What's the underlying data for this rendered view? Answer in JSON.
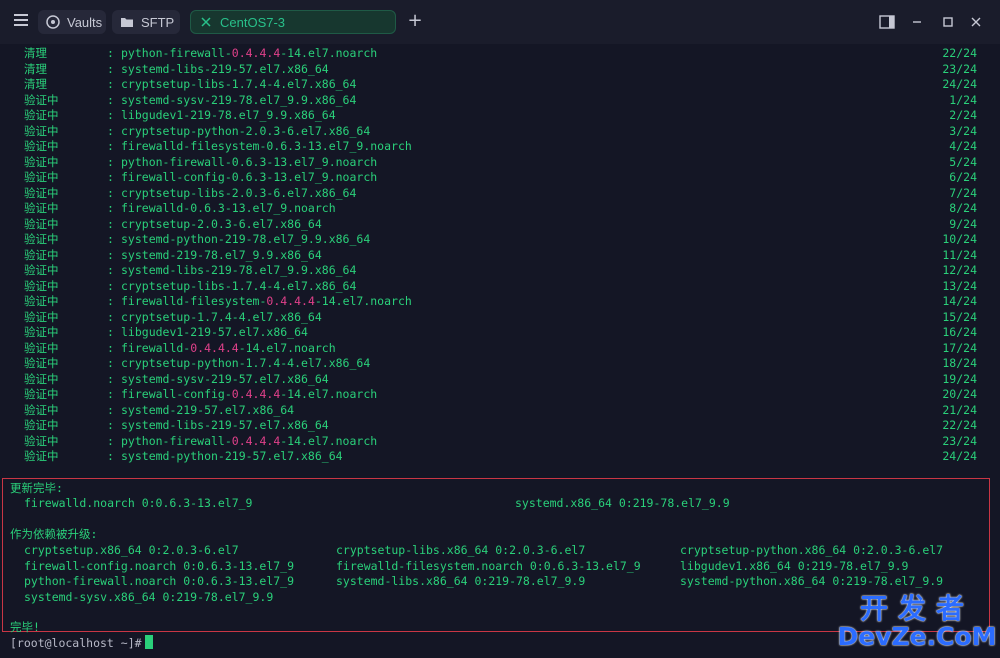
{
  "tabs": [
    {
      "label": "Vaults",
      "icon": "vault-icon"
    },
    {
      "label": "SFTP",
      "icon": "folder-icon"
    },
    {
      "label": "CentOS7-3",
      "icon": "close-icon"
    }
  ],
  "colors": {
    "accent": "#28c08a",
    "text": "#2ad07a",
    "highlight": "#e0408a",
    "frame": "#c93645",
    "background": "#141625"
  },
  "rows": [
    {
      "status": "清理",
      "pkg_pre": "python-firewall-",
      "pkg_ver": "0.4.4.4",
      "pkg_post": "-14.el7.noarch",
      "count": "22/24"
    },
    {
      "status": "清理",
      "pkg_pre": "systemd-libs-219-57.el7.x86_64",
      "pkg_ver": "",
      "pkg_post": "",
      "count": "23/24"
    },
    {
      "status": "清理",
      "pkg_pre": "cryptsetup-libs-1.7.4-4.el7.x86_64",
      "pkg_ver": "",
      "pkg_post": "",
      "count": "24/24"
    },
    {
      "status": "验证中",
      "pkg_pre": "systemd-sysv-219-78.el7_9.9.x86_64",
      "pkg_ver": "",
      "pkg_post": "",
      "count": "1/24"
    },
    {
      "status": "验证中",
      "pkg_pre": "libgudev1-219-78.el7_9.9.x86_64",
      "pkg_ver": "",
      "pkg_post": "",
      "count": "2/24"
    },
    {
      "status": "验证中",
      "pkg_pre": "cryptsetup-python-2.0.3-6.el7.x86_64",
      "pkg_ver": "",
      "pkg_post": "",
      "count": "3/24"
    },
    {
      "status": "验证中",
      "pkg_pre": "firewalld-filesystem-0.6.3-13.el7_9.noarch",
      "pkg_ver": "",
      "pkg_post": "",
      "count": "4/24"
    },
    {
      "status": "验证中",
      "pkg_pre": "python-firewall-0.6.3-13.el7_9.noarch",
      "pkg_ver": "",
      "pkg_post": "",
      "count": "5/24"
    },
    {
      "status": "验证中",
      "pkg_pre": "firewall-config-0.6.3-13.el7_9.noarch",
      "pkg_ver": "",
      "pkg_post": "",
      "count": "6/24"
    },
    {
      "status": "验证中",
      "pkg_pre": "cryptsetup-libs-2.0.3-6.el7.x86_64",
      "pkg_ver": "",
      "pkg_post": "",
      "count": "7/24"
    },
    {
      "status": "验证中",
      "pkg_pre": "firewalld-0.6.3-13.el7_9.noarch",
      "pkg_ver": "",
      "pkg_post": "",
      "count": "8/24"
    },
    {
      "status": "验证中",
      "pkg_pre": "cryptsetup-2.0.3-6.el7.x86_64",
      "pkg_ver": "",
      "pkg_post": "",
      "count": "9/24"
    },
    {
      "status": "验证中",
      "pkg_pre": "systemd-python-219-78.el7_9.9.x86_64",
      "pkg_ver": "",
      "pkg_post": "",
      "count": "10/24"
    },
    {
      "status": "验证中",
      "pkg_pre": "systemd-219-78.el7_9.9.x86_64",
      "pkg_ver": "",
      "pkg_post": "",
      "count": "11/24"
    },
    {
      "status": "验证中",
      "pkg_pre": "systemd-libs-219-78.el7_9.9.x86_64",
      "pkg_ver": "",
      "pkg_post": "",
      "count": "12/24"
    },
    {
      "status": "验证中",
      "pkg_pre": "cryptsetup-libs-1.7.4-4.el7.x86_64",
      "pkg_ver": "",
      "pkg_post": "",
      "count": "13/24"
    },
    {
      "status": "验证中",
      "pkg_pre": "firewalld-filesystem-",
      "pkg_ver": "0.4.4.4",
      "pkg_post": "-14.el7.noarch",
      "count": "14/24"
    },
    {
      "status": "验证中",
      "pkg_pre": "cryptsetup-1.7.4-4.el7.x86_64",
      "pkg_ver": "",
      "pkg_post": "",
      "count": "15/24"
    },
    {
      "status": "验证中",
      "pkg_pre": "libgudev1-219-57.el7.x86_64",
      "pkg_ver": "",
      "pkg_post": "",
      "count": "16/24"
    },
    {
      "status": "验证中",
      "pkg_pre": "firewalld-",
      "pkg_ver": "0.4.4.4",
      "pkg_post": "-14.el7.noarch",
      "count": "17/24"
    },
    {
      "status": "验证中",
      "pkg_pre": "cryptsetup-python-1.7.4-4.el7.x86_64",
      "pkg_ver": "",
      "pkg_post": "",
      "count": "18/24"
    },
    {
      "status": "验证中",
      "pkg_pre": "systemd-sysv-219-57.el7.x86_64",
      "pkg_ver": "",
      "pkg_post": "",
      "count": "19/24"
    },
    {
      "status": "验证中",
      "pkg_pre": "firewall-config-",
      "pkg_ver": "0.4.4.4",
      "pkg_post": "-14.el7.noarch",
      "count": "20/24"
    },
    {
      "status": "验证中",
      "pkg_pre": "systemd-219-57.el7.x86_64",
      "pkg_ver": "",
      "pkg_post": "",
      "count": "21/24"
    },
    {
      "status": "验证中",
      "pkg_pre": "systemd-libs-219-57.el7.x86_64",
      "pkg_ver": "",
      "pkg_post": "",
      "count": "22/24"
    },
    {
      "status": "验证中",
      "pkg_pre": "python-firewall-",
      "pkg_ver": "0.4.4.4",
      "pkg_post": "-14.el7.noarch",
      "count": "23/24"
    },
    {
      "status": "验证中",
      "pkg_pre": "systemd-python-219-57.el7.x86_64",
      "pkg_ver": "",
      "pkg_post": "",
      "count": "24/24"
    }
  ],
  "updated": {
    "heading": "更新完毕:",
    "items": [
      "firewalld.noarch 0:0.6.3-13.el7_9",
      "systemd.x86_64 0:219-78.el7_9.9"
    ]
  },
  "deps": {
    "heading": "作为依赖被升级:",
    "rows": [
      [
        "cryptsetup.x86_64 0:2.0.3-6.el7",
        "cryptsetup-libs.x86_64 0:2.0.3-6.el7",
        "cryptsetup-python.x86_64 0:2.0.3-6.el7"
      ],
      [
        "firewall-config.noarch 0:0.6.3-13.el7_9",
        "firewalld-filesystem.noarch 0:0.6.3-13.el7_9",
        "libgudev1.x86_64 0:219-78.el7_9.9"
      ],
      [
        "python-firewall.noarch 0:0.6.3-13.el7_9",
        "systemd-libs.x86_64 0:219-78.el7_9.9",
        "systemd-python.x86_64 0:219-78.el7_9.9"
      ],
      [
        "systemd-sysv.x86_64 0:219-78.el7_9.9",
        "",
        ""
      ]
    ]
  },
  "done": "完毕!",
  "prompt": "[root@localhost ~]#",
  "watermark": {
    "top": "开发者",
    "bottom": "DevZe.CoM"
  }
}
